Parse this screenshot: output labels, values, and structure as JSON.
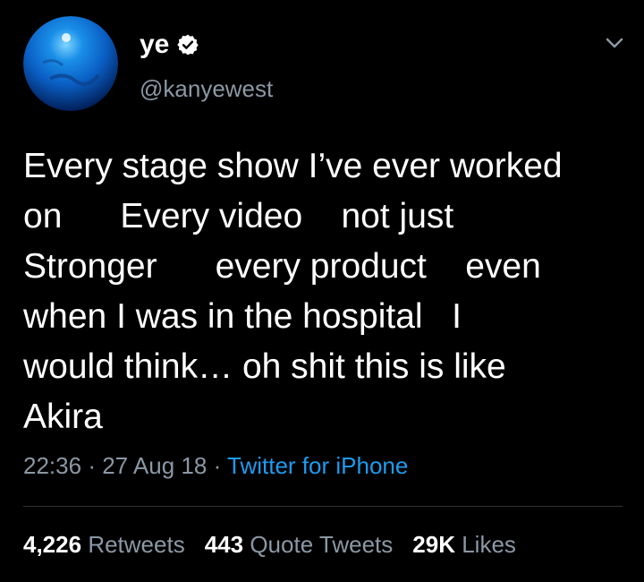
{
  "tweet": {
    "display_name": "ye",
    "handle": "@kanyewest",
    "text": "Every stage show I’ve ever worked\non      Every video    not just\nStronger      every product    even\nwhen I was in the hospital   I\nwould think… oh shit this is like\nAkira",
    "time": "22:36",
    "separator": "·",
    "date": "27 Aug 18",
    "source": "Twitter for iPhone"
  },
  "stats": {
    "retweets_count": "4,226",
    "retweets_label": "Retweets",
    "quotes_count": "443",
    "quotes_label": "Quote Tweets",
    "likes_count": "29K",
    "likes_label": "Likes"
  },
  "icons": {
    "verified": "verified-badge-icon",
    "more": "chevron-down-icon"
  },
  "colors": {
    "background": "#000000",
    "text": "#ffffff",
    "secondary": "#8b98a5",
    "link": "#1d9bf0",
    "divider": "#2f3336"
  }
}
